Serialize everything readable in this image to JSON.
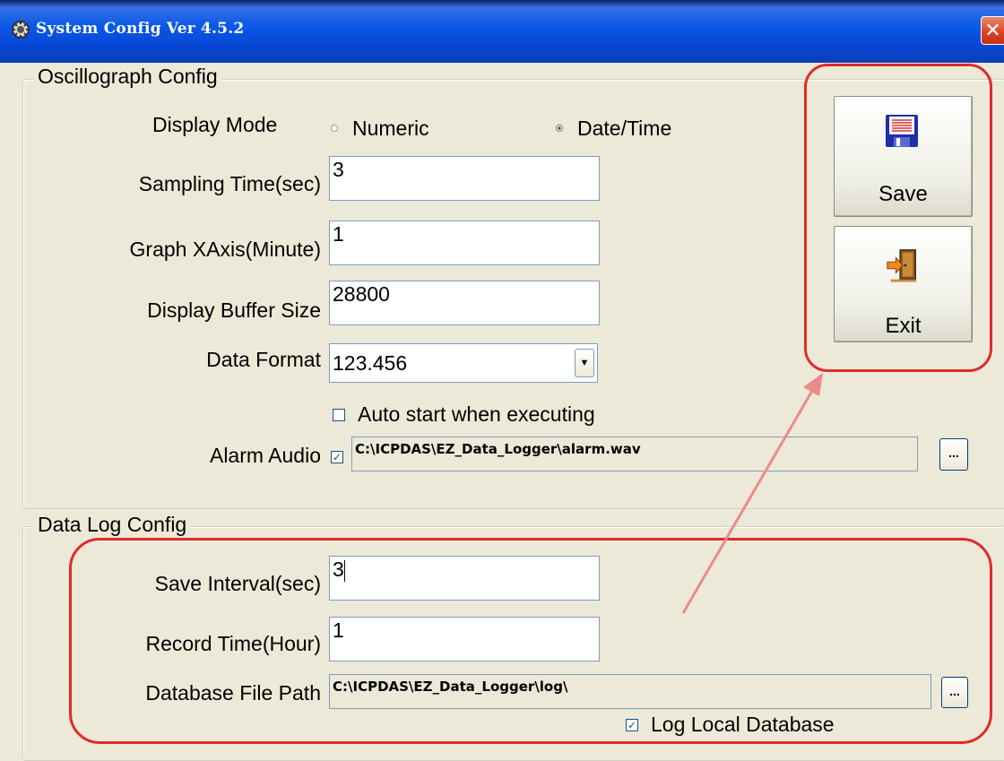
{
  "window": {
    "title": "System Config Ver 4.5.2",
    "close_glyph": "✕"
  },
  "oscillograph": {
    "title": "Oscillograph Config",
    "display_mode": {
      "label": "Display Mode",
      "options": [
        "Numeric",
        "Date/Time"
      ],
      "selected": "Date/Time"
    },
    "sampling_time": {
      "label": "Sampling Time(sec)",
      "value": "3"
    },
    "graph_xaxis": {
      "label": "Graph XAxis(Minute)",
      "value": "1"
    },
    "buffer_size": {
      "label": "Display Buffer Size",
      "value": "28800"
    },
    "data_format": {
      "label": "Data Format",
      "value": "123.456"
    },
    "auto_start": {
      "label": "Auto start when executing",
      "checked": false
    },
    "alarm_audio": {
      "label": "Alarm Audio",
      "checked": true,
      "path": "C:\\ICPDAS\\EZ_Data_Logger\\alarm.wav",
      "browse_label": "..."
    }
  },
  "datalog": {
    "title": "Data Log Config",
    "save_interval": {
      "label": "Save Interval(sec)",
      "value": "3"
    },
    "record_time": {
      "label": "Record Time(Hour)",
      "value": "1"
    },
    "db_path": {
      "label": "Database File Path",
      "value": "C:\\ICPDAS\\EZ_Data_Logger\\log\\",
      "browse_label": "..."
    },
    "log_local": {
      "label": "Log Local Database",
      "checked": true
    }
  },
  "buttons": {
    "save_label": "Save",
    "exit_label": "Exit"
  },
  "colors": {
    "annotation": "#e02a2a",
    "titlebar": "#0a5ae8"
  },
  "icons": [
    "app-gear-icon",
    "floppy-save-icon",
    "door-exit-icon",
    "close-icon",
    "dropdown-arrow-icon"
  ]
}
